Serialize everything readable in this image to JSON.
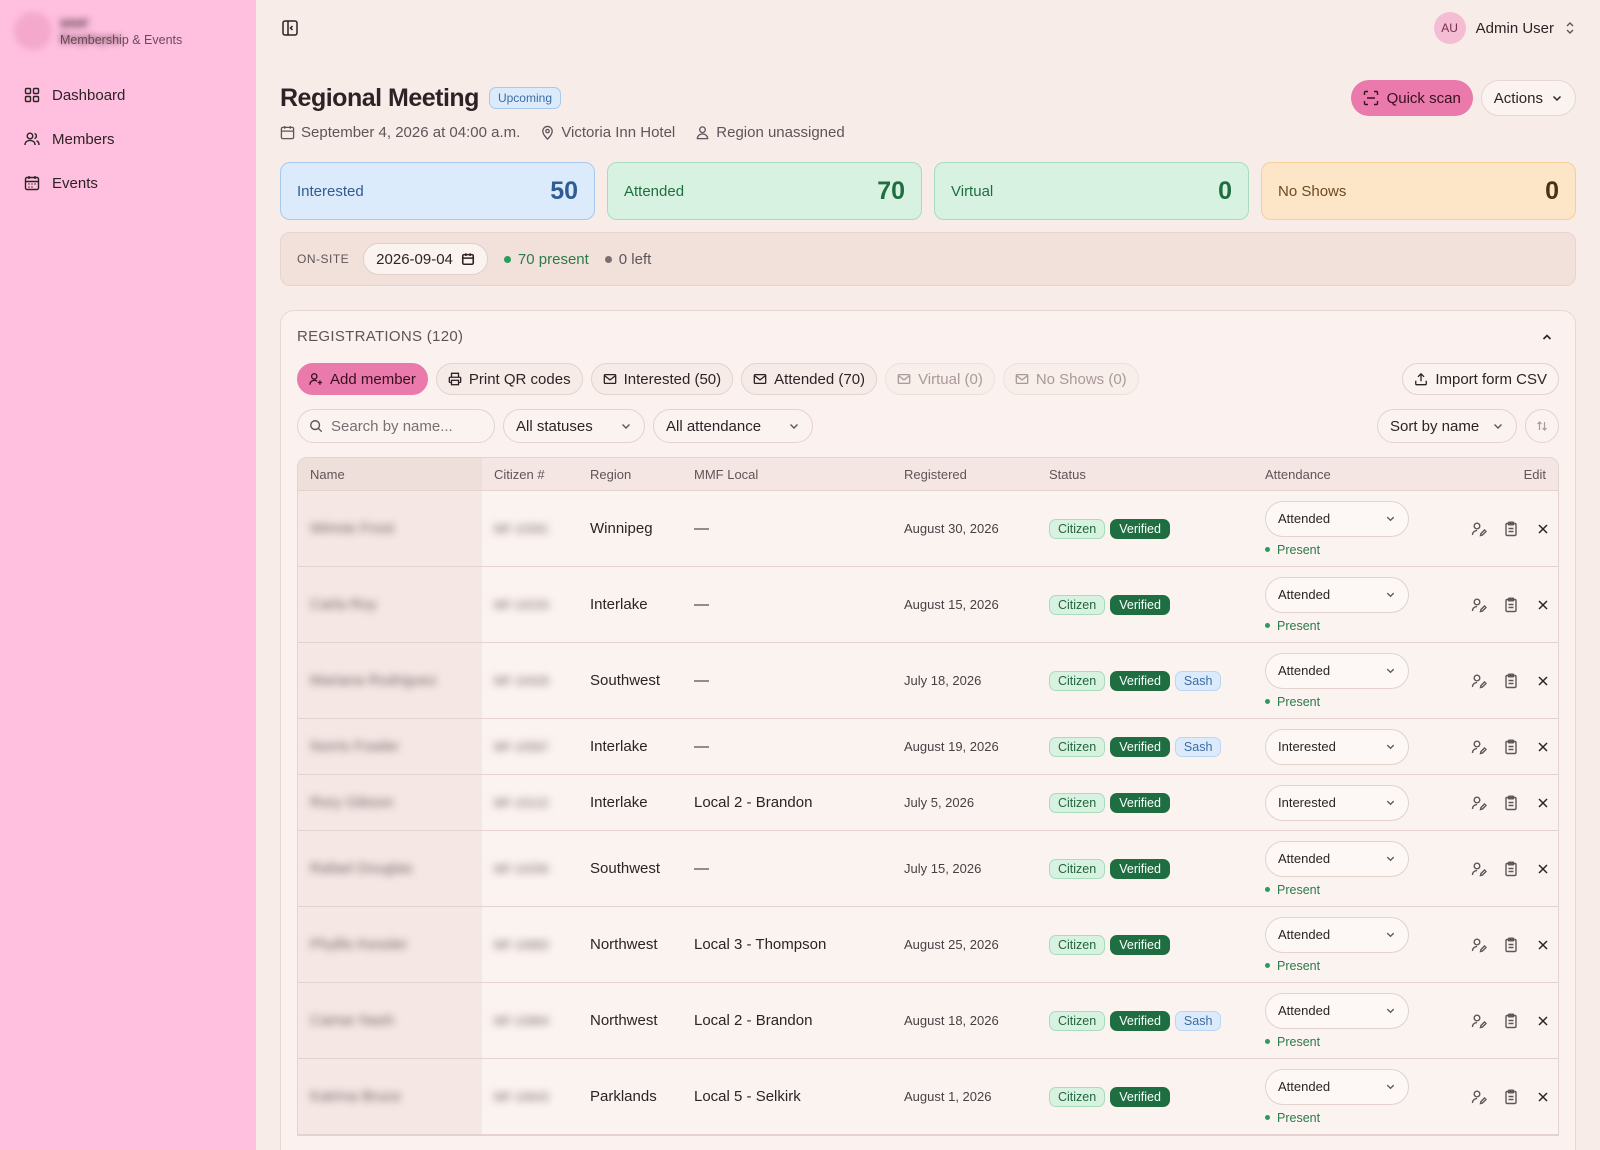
{
  "sidebar": {
    "brand_name": "MMF Employee",
    "brand_sub": "Membership & Events",
    "items": [
      {
        "label": "Dashboard",
        "icon": "grid-icon"
      },
      {
        "label": "Members",
        "icon": "users-icon"
      },
      {
        "label": "Events",
        "icon": "calendar-icon"
      }
    ]
  },
  "user": {
    "initials": "AU",
    "name": "Admin User"
  },
  "event": {
    "title": "Regional Meeting",
    "badge": "Upcoming",
    "date": "September 4, 2026 at 04:00 a.m.",
    "location": "Victoria Inn Hotel",
    "region": "Region unassigned"
  },
  "actions": {
    "quick_scan": "Quick scan",
    "actions": "Actions"
  },
  "stats": [
    {
      "label": "Interested",
      "value": "50",
      "bg": "#dcebfb",
      "border": "#a9c8ee",
      "label_color": "#2f5c92",
      "value_color": "#2f5c92"
    },
    {
      "label": "Attended",
      "value": "70",
      "bg": "#d8f2e1",
      "border": "#a8dcbc",
      "label_color": "#1f6e42",
      "value_color": "#1f6e42"
    },
    {
      "label": "Virtual",
      "value": "0",
      "bg": "#d8f2e1",
      "border": "#a8dcbc",
      "label_color": "#1f6e42",
      "value_color": "#1f6e42"
    },
    {
      "label": "No Shows",
      "value": "0",
      "bg": "#fde6c8",
      "border": "#f4cf9a",
      "label_color": "#6b4a22",
      "value_color": "#4a3216"
    }
  ],
  "onsite": {
    "label": "ON-SITE",
    "date": "2026-09-04",
    "present": "70 present",
    "left": "0 left"
  },
  "registrations": {
    "heading": "REGISTRATIONS (120)",
    "buttons": {
      "add_member": "Add member",
      "print_qr": "Print QR codes",
      "interested": "Interested (50)",
      "attended": "Attended (70)",
      "virtual": "Virtual (0)",
      "no_shows": "No Shows (0)",
      "import_csv": "Import form CSV"
    },
    "search_placeholder": "Search by name...",
    "filter_status": "All statuses",
    "filter_attendance": "All attendance",
    "sort": "Sort by name",
    "columns": [
      "Name",
      "Citizen #",
      "Region",
      "MMF Local",
      "Registered",
      "Status",
      "Attendance",
      "Edit"
    ],
    "rows": [
      {
        "name": "Winnie Frost",
        "citizen": "MF-10391",
        "region": "Winnipeg",
        "local": "—",
        "registered": "August 30, 2026",
        "tags": [
          "Citizen",
          "Verified"
        ],
        "attendance": "Attended",
        "present": "Present"
      },
      {
        "name": "Carla Roy",
        "citizen": "MF-10233",
        "region": "Interlake",
        "local": "—",
        "registered": "August 15, 2026",
        "tags": [
          "Citizen",
          "Verified"
        ],
        "attendance": "Attended",
        "present": "Present"
      },
      {
        "name": "Mariana Rodriguez",
        "citizen": "MF-10428",
        "region": "Southwest",
        "local": "—",
        "registered": "July 18, 2026",
        "tags": [
          "Citizen",
          "Verified",
          "Sash"
        ],
        "attendance": "Attended",
        "present": "Present"
      },
      {
        "name": "Norris Fowler",
        "citizen": "MF-10587",
        "region": "Interlake",
        "local": "—",
        "registered": "August 19, 2026",
        "tags": [
          "Citizen",
          "Verified",
          "Sash"
        ],
        "attendance": "Interested",
        "present": ""
      },
      {
        "name": "Rory Gibson",
        "citizen": "MF-10122",
        "region": "Interlake",
        "local": "Local 2 - Brandon",
        "registered": "July 5, 2026",
        "tags": [
          "Citizen",
          "Verified"
        ],
        "attendance": "Interested",
        "present": ""
      },
      {
        "name": "Rafael Douglas",
        "citizen": "MF-10256",
        "region": "Southwest",
        "local": "—",
        "registered": "July 15, 2026",
        "tags": [
          "Citizen",
          "Verified"
        ],
        "attendance": "Attended",
        "present": "Present"
      },
      {
        "name": "Phyllis Kessler",
        "citizen": "MF-10883",
        "region": "Northwest",
        "local": "Local 3 - Thompson",
        "registered": "August 25, 2026",
        "tags": [
          "Citizen",
          "Verified"
        ],
        "attendance": "Attended",
        "present": "Present"
      },
      {
        "name": "Camar Nash",
        "citizen": "MF-10964",
        "region": "Northwest",
        "local": "Local 2 - Brandon",
        "registered": "August 18, 2026",
        "tags": [
          "Citizen",
          "Verified",
          "Sash"
        ],
        "attendance": "Attended",
        "present": "Present"
      },
      {
        "name": "Katrina Bruce",
        "citizen": "MF-10643",
        "region": "Parklands",
        "local": "Local 5 - Selkirk",
        "registered": "August 1, 2026",
        "tags": [
          "Citizen",
          "Verified"
        ],
        "attendance": "Attended",
        "present": "Present"
      }
    ]
  }
}
